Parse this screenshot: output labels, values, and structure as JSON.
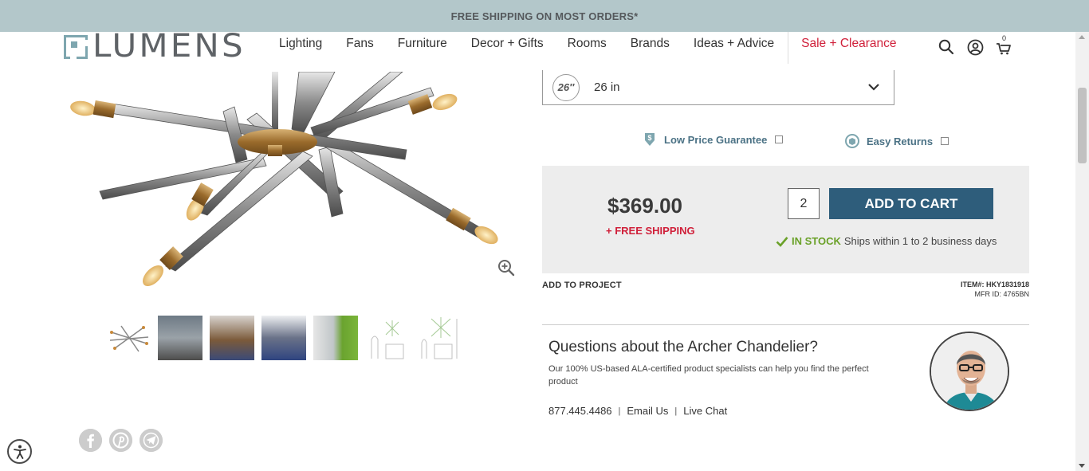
{
  "promo": {
    "text": "FREE SHIPPING ON MOST ORDERS*"
  },
  "logo": {
    "text": "LUMENS"
  },
  "nav": {
    "items": [
      "Lighting",
      "Fans",
      "Furniture",
      "Decor + Gifts",
      "Rooms",
      "Brands",
      "Ideas + Advice"
    ],
    "sale_label": "Sale + Clearance"
  },
  "header_icons": {
    "cart_count": "0"
  },
  "size_select": {
    "badge": "26″",
    "value": "26 in"
  },
  "guarantees": {
    "low_price": "Low Price Guarantee",
    "easy_returns": "Easy Returns"
  },
  "buy_box": {
    "price": "$369.00",
    "free_shipping": "+ FREE SHIPPING",
    "quantity": "2",
    "add_to_cart": "ADD TO CART",
    "in_stock": "IN STOCK",
    "ships_within": "Ships within 1 to 2 business days"
  },
  "add_to_project": "ADD TO PROJECT",
  "item_info": {
    "item": "ITEM#: HKY1831918",
    "mfr": "MFR ID: 4765BN"
  },
  "questions": {
    "title": "Questions about the Archer Chandelier?",
    "description": "Our 100% US-based ALA-certified product specialists can help you find the perfect product",
    "phone": "877.445.4486",
    "email": "Email Us",
    "chat": "Live Chat"
  },
  "colors": {
    "accent": "#2e5d7b",
    "sale": "#d0203a",
    "promo_bg": "#b3c7ca",
    "in_stock": "#6aa128"
  }
}
